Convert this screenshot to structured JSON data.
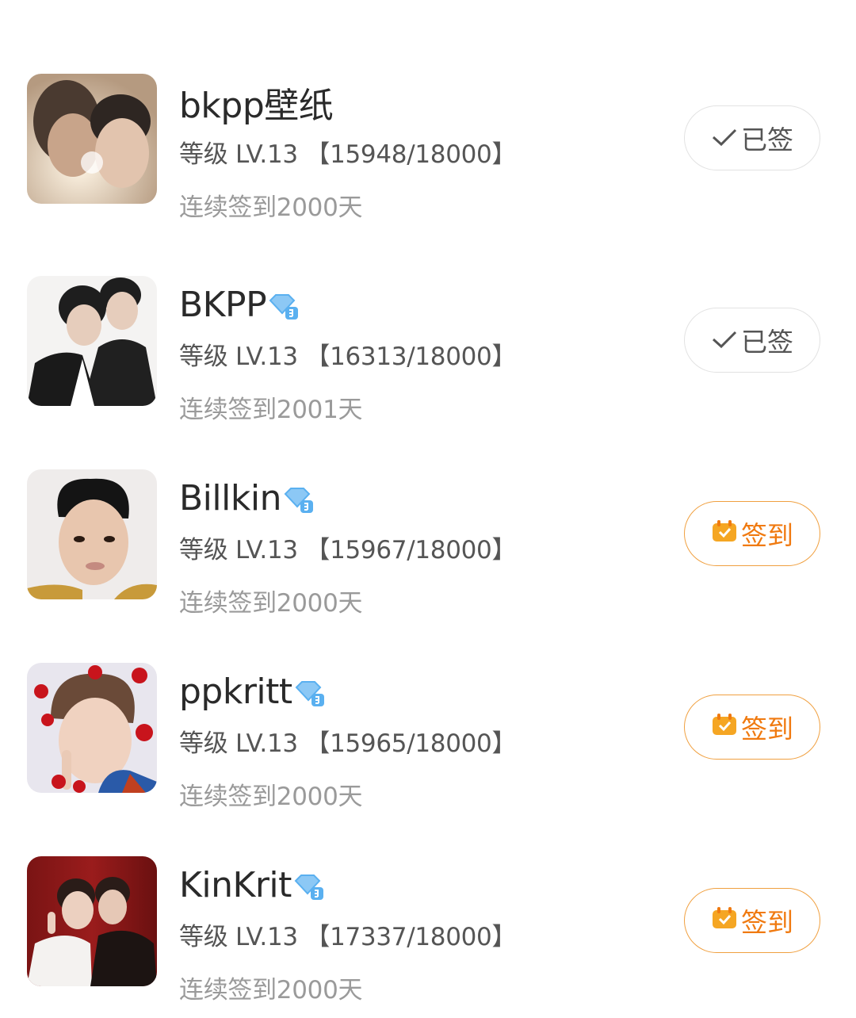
{
  "colors": {
    "name": "#2a2a2a",
    "level": "#555555",
    "streak": "#9a9a9a",
    "signed_border": "#e2e2e2",
    "sign_accent": "#f07a10",
    "badge_blue": "#5ab0f0"
  },
  "forums": [
    {
      "name": "bkpp壁纸",
      "has_badge": false,
      "level": "等级 LV.13 【15948/18000】",
      "streak": "连续签到2000天",
      "signed": true,
      "button_label": "已签",
      "button_icon": "check-icon"
    },
    {
      "name": "BKPP",
      "has_badge": true,
      "level": "等级 LV.13 【16313/18000】",
      "streak": "连续签到2001天",
      "signed": true,
      "button_label": "已签",
      "button_icon": "check-icon"
    },
    {
      "name": "Billkin",
      "has_badge": true,
      "level": "等级 LV.13 【15967/18000】",
      "streak": "连续签到2000天",
      "signed": false,
      "button_label": "签到",
      "button_icon": "calendar-icon"
    },
    {
      "name": "ppkritt",
      "has_badge": true,
      "level": "等级 LV.13 【15965/18000】",
      "streak": "连续签到2000天",
      "signed": false,
      "button_label": "签到",
      "button_icon": "calendar-icon"
    },
    {
      "name": "KinKrit",
      "has_badge": true,
      "level": "等级 LV.13 【17337/18000】",
      "streak": "连续签到2000天",
      "signed": false,
      "button_label": "签到",
      "button_icon": "calendar-icon"
    }
  ]
}
